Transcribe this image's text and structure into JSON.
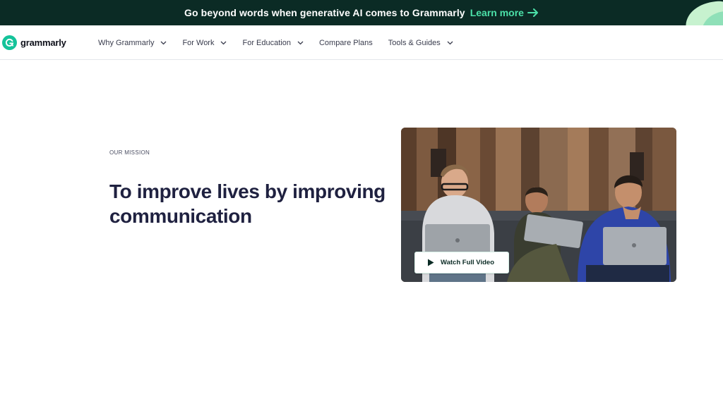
{
  "banner": {
    "text": "Go beyond words when generative AI comes to Grammarly",
    "link_label": "Learn more",
    "bg_color": "#0b2b25",
    "link_color": "#4be0a8"
  },
  "header": {
    "logo_text": "grammarly",
    "nav": [
      {
        "label": "Why Grammarly",
        "has_dropdown": true
      },
      {
        "label": "For Work",
        "has_dropdown": true
      },
      {
        "label": "For Education",
        "has_dropdown": true
      },
      {
        "label": "Compare Plans",
        "has_dropdown": false
      },
      {
        "label": "Tools & Guides",
        "has_dropdown": true
      }
    ]
  },
  "hero": {
    "eyebrow": "OUR MISSION",
    "headline": "To improve lives by improving communication",
    "video_button_label": "Watch Full Video"
  },
  "colors": {
    "brand_green": "#15c39a",
    "headline": "#1f2140"
  }
}
